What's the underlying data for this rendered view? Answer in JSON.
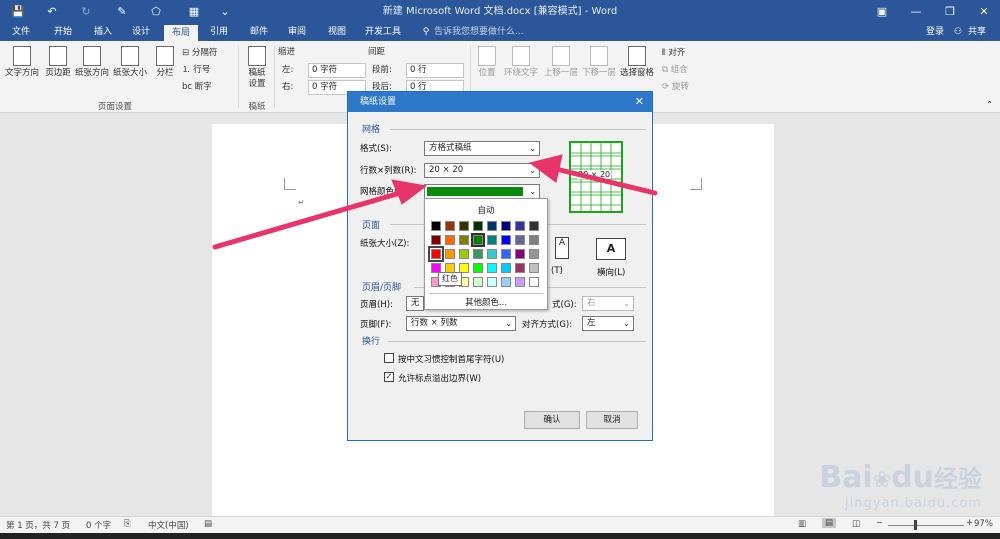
{
  "window": {
    "title": "新建 Microsoft Word 文档.docx [兼容模式] - Word",
    "controls": [
      "▣",
      "—",
      "❐",
      "✕"
    ]
  },
  "tabs": [
    "文件",
    "开始",
    "插入",
    "设计",
    "布局",
    "引用",
    "邮件",
    "审阅",
    "视图",
    "开发工具"
  ],
  "active_tab": "布局",
  "tellme": "告诉我您想要做什么...",
  "login": "登录",
  "share": "共享",
  "ribbon": {
    "page_setup": {
      "text_direction": "文字方向",
      "margins": "页边距",
      "orientation": "纸张方向",
      "size": "纸张大小",
      "columns": "分栏",
      "breaks": "分隔符",
      "line_numbers": "行号",
      "hyphenation": "断字",
      "group_label": "页面设置"
    },
    "manuscript": {
      "button": "稿纸\n设置",
      "group_label": "稿纸"
    },
    "indent": {
      "title": "缩进",
      "left_label": "左:",
      "left_value": "0 字符",
      "right_label": "右:",
      "right_value": "0 字符"
    },
    "spacing": {
      "title": "间距",
      "before_label": "段前:",
      "before_value": "0 行",
      "after_label": "段后:",
      "after_value": "0 行"
    },
    "arrange": {
      "position": "位置",
      "wrap_text": "环绕文字",
      "bring_forward": "上移一层",
      "send_backward": "下移一层",
      "selection_pane": "选择窗格",
      "align": "对齐",
      "group": "组合",
      "rotate": "旋转"
    }
  },
  "dialog": {
    "title": "稿纸设置",
    "close": "✕",
    "grid_section": "网格",
    "style_label": "格式(S):",
    "style_value": "方格式稿纸",
    "rows_cols_label": "行数×列数(R):",
    "rows_cols_value": "20 × 20",
    "grid_color_label": "网格颜色(C):",
    "grid_color": "#0a8a0a",
    "paper_section": "页面",
    "paper_size_label": "纸张大小(Z):",
    "portrait_label": "(T)",
    "landscape_label": "横向(L)",
    "header_footer_section": "页眉/页脚",
    "header_label": "页眉(H):",
    "header_value": "无",
    "footer_label": "页脚(F):",
    "footer_value": "行数 × 列数",
    "align_label": "对齐方式(G):",
    "header_align_value": "右",
    "footer_align_value": "左",
    "header_align_partial": "式(G):",
    "wrap_section": "换行",
    "opt1": "按中文习惯控制首尾字符(U)",
    "opt1_checked": false,
    "opt2": "允许标点溢出边界(W)",
    "opt2_checked": true,
    "ok": "确认",
    "cancel": "取消",
    "preview_text": "20 × 20"
  },
  "color_picker": {
    "auto": "自动",
    "more": "其他颜色...",
    "tooltip": "红色",
    "selected": "#008000",
    "hovered": "#ff0000",
    "rows": [
      [
        "#000000",
        "#993300",
        "#333300",
        "#003300",
        "#003366",
        "#000080",
        "#333399",
        "#333333"
      ],
      [
        "#800000",
        "#ff6600",
        "#808000",
        "#008000",
        "#008080",
        "#0000ff",
        "#666699",
        "#808080"
      ],
      [
        "#ff0000",
        "#ff9900",
        "#99cc00",
        "#339966",
        "#33cccc",
        "#3366ff",
        "#800080",
        "#969696"
      ],
      [
        "#ff00ff",
        "#ffcc00",
        "#ffff00",
        "#00ff00",
        "#00ffff",
        "#00ccff",
        "#993366",
        "#c0c0c0"
      ],
      [
        "#ff99cc",
        "#ffcc99",
        "#ffff99",
        "#ccffcc",
        "#ccffff",
        "#99ccff",
        "#cc99ff",
        "#ffffff"
      ]
    ]
  },
  "statusbar": {
    "page": "第 1 页，共 7 页",
    "words": "0 个字",
    "lang": "中文(中国)",
    "zoom": "97%"
  },
  "watermark": {
    "brand": "Bai",
    "paw": "du",
    "cn": "经验",
    "url": "jingyan.baidu.com"
  },
  "colors": {
    "word_blue": "#2b579a",
    "arrow": "#e8336b",
    "grid_green": "#19a619"
  }
}
